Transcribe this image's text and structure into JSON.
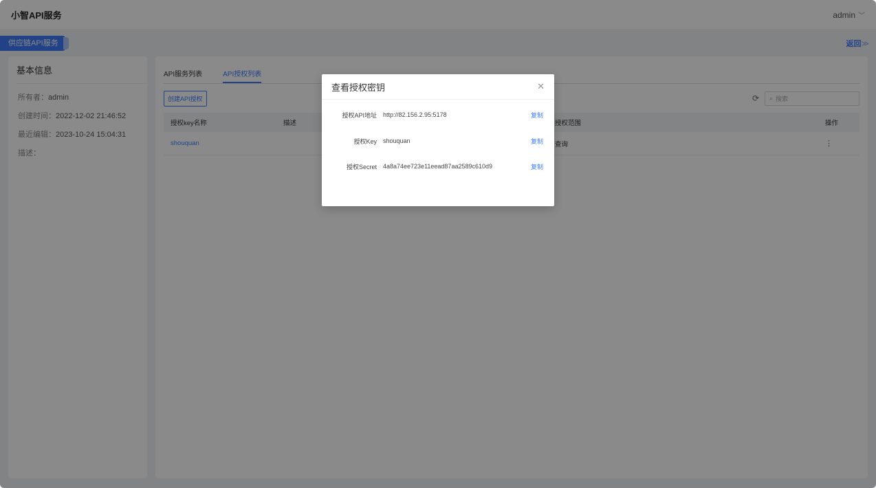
{
  "header": {
    "brand": "小智API服务",
    "user": "admin"
  },
  "subbar": {
    "service_tag": "供应链API服务",
    "back_label": "返回",
    "back_arrow": "≫"
  },
  "info": {
    "title": "基本信息",
    "owner_label": "所有者：",
    "owner": "admin",
    "created_label": "创建时间：",
    "created": "2022-12-02 21:46:52",
    "edited_label": "最近编辑：",
    "edited": "2023-10-24 15:04:31",
    "desc_label": "描述："
  },
  "tabs": [
    "API服务列表",
    "API授权列表"
  ],
  "toolbar": {
    "create_label": "创建API授权",
    "search_placeholder": "搜索"
  },
  "table": {
    "headers": [
      "授权key名称",
      "描述",
      "授权范围",
      "操作"
    ],
    "rows": [
      {
        "name": "shouquan",
        "desc": "",
        "scope": "查询",
        "ops": "⋮"
      }
    ]
  },
  "modal": {
    "title": "查看授权密钥",
    "rows": [
      {
        "key": "授权API地址",
        "value": "http://82.156.2.95:5178",
        "copy": "复制"
      },
      {
        "key": "授权Key",
        "value": "shouquan",
        "copy": "复制"
      },
      {
        "key": "授权Secret",
        "value": "4a8a74ee723e11eead87aa2589c610d9",
        "copy": "复制"
      }
    ]
  },
  "colors": {
    "accent": "#3e7bfa",
    "overlay": "rgba(0,0,0,0.46)"
  }
}
